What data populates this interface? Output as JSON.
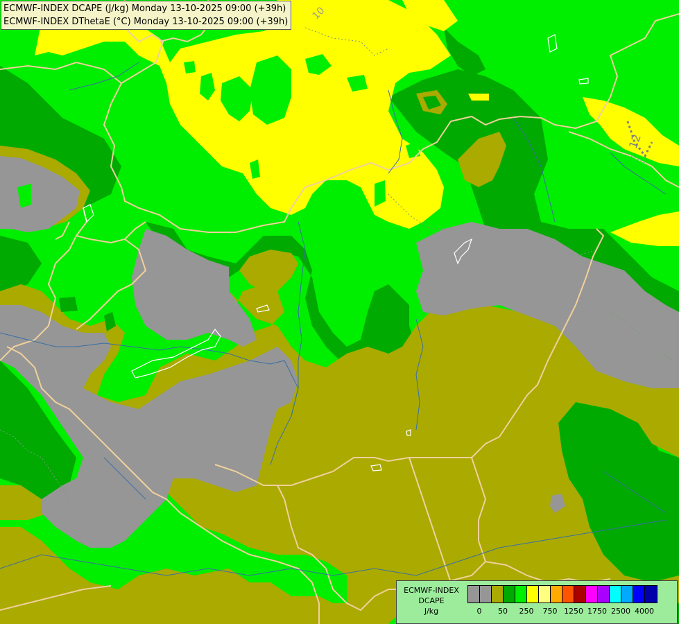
{
  "title": {
    "line1": "ECMWF-INDEX DCAPE (J/kg) Monday 13-10-2025 09:00 (+39h)",
    "line2": "ECMWF-INDEX DThetaE (°C) Monday 13-10-2025 09:00 (+39h)"
  },
  "contour_labels": [
    "10",
    "12"
  ],
  "legend": {
    "model": "ECMWF-INDEX",
    "param": "DCAPE",
    "unit": "J/kg",
    "colors": [
      "#969696",
      "#969696",
      "#aaaa00",
      "#00aa00",
      "#00ee00",
      "#ffff00",
      "#ffff80",
      "#ffaa00",
      "#ff5500",
      "#aa0000",
      "#ff00ff",
      "#aa00ff",
      "#00ffff",
      "#00aaff",
      "#0000ff",
      "#0000aa"
    ],
    "ticks": [
      "0",
      "50",
      "250",
      "750",
      "1250",
      "1750",
      "2500",
      "4000"
    ]
  },
  "colors": {
    "gray": "#969696",
    "olive": "#aaaa00",
    "dark_green": "#00aa00",
    "green": "#00ee00",
    "yellow": "#ffff00",
    "border": "#f0d09c",
    "river": "#3a6ea5"
  }
}
